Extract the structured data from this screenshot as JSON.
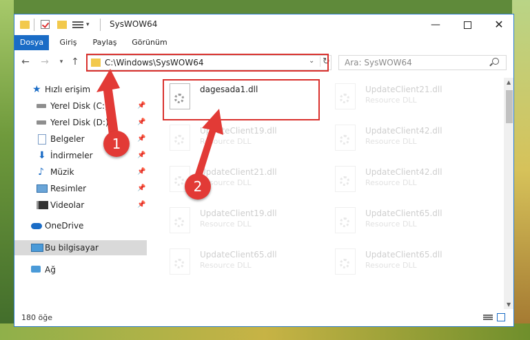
{
  "window": {
    "title": "SysWOW64",
    "controls": {
      "minimize": "—",
      "maximize": "",
      "close": "✕"
    }
  },
  "ribbon": {
    "tabs": [
      {
        "label": "Dosya",
        "active": true
      },
      {
        "label": "Giriş"
      },
      {
        "label": "Paylaş"
      },
      {
        "label": "Görünüm"
      }
    ]
  },
  "address": {
    "path": "C:\\Windows\\SysWOW64",
    "search_placeholder": "Ara: SysWOW64"
  },
  "sidebar": {
    "items": [
      {
        "label": "Hızlı erişim",
        "icon": "star-icon"
      },
      {
        "label": "Yerel Disk (C:)",
        "icon": "drive-icon",
        "pinned": true
      },
      {
        "label": "Yerel Disk (D:)",
        "icon": "drive-icon",
        "pinned": true
      },
      {
        "label": "Belgeler",
        "icon": "document-icon",
        "pinned": true
      },
      {
        "label": "İndirmeler",
        "icon": "download-icon",
        "pinned": true
      },
      {
        "label": "Müzik",
        "icon": "music-icon",
        "pinned": true
      },
      {
        "label": "Resimler",
        "icon": "pictures-icon",
        "pinned": true
      },
      {
        "label": "Videolar",
        "icon": "videos-icon",
        "pinned": true
      },
      {
        "label": "OneDrive",
        "icon": "cloud-icon"
      },
      {
        "label": "Bu bilgisayar",
        "icon": "computer-icon",
        "selected": true
      },
      {
        "label": "Ağ",
        "icon": "network-icon"
      }
    ]
  },
  "files": {
    "highlighted": {
      "name": "dagesada1.dll"
    },
    "items": [
      {
        "name": "UpdateClient21.dll",
        "type": "Resource DLL"
      },
      {
        "name": "UpdateClient19.dll",
        "type": "Resource DLL"
      },
      {
        "name": "UpdateClient42.dll",
        "type": "Resource DLL"
      },
      {
        "name": "UpdateClient21.dll",
        "type": "Resource DLL"
      },
      {
        "name": "UpdateClient42.dll",
        "type": "Resource DLL"
      },
      {
        "name": "UpdateClient19.dll",
        "type": "Resource DLL"
      },
      {
        "name": "UpdateClient65.dll",
        "type": "Resource DLL"
      },
      {
        "name": "UpdateClient65.dll",
        "type": "Resource DLL"
      },
      {
        "name": "UpdateClient65.dll",
        "type": "Resource DLL"
      }
    ]
  },
  "status": {
    "item_count": "180 öğe"
  },
  "annotations": {
    "badge1": "1",
    "badge2": "2",
    "color": "#e23a36"
  }
}
